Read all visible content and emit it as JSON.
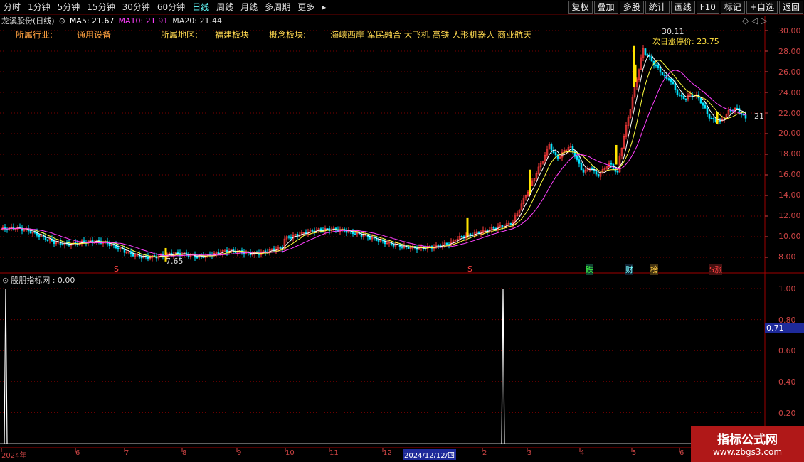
{
  "toolbar": {
    "periods": [
      "分时",
      "1分钟",
      "5分钟",
      "15分钟",
      "30分钟",
      "60分钟",
      "日线",
      "周线",
      "月线",
      "多周期",
      "更多"
    ],
    "buttons": [
      "复权",
      "叠加",
      "多股",
      "统计",
      "画线",
      "F10",
      "标记",
      "+自选",
      "返回"
    ]
  },
  "chart_header": {
    "stock": "龙溪股份(日线)",
    "ma5": "MA5: 21.67",
    "ma10": "MA10: 21.91",
    "ma20": "MA20: 21.44"
  },
  "tags": {
    "industry_label": "所属行业:",
    "industry_value": "通用设备",
    "region_label": "所属地区:",
    "region_value": "福建板块",
    "concept_label": "概念板块:",
    "concept_value": "海峡西岸 军民融合 大飞机 高铁 人形机器人 商业航天"
  },
  "notes": {
    "high": "30.11",
    "low": "7.65",
    "limit_up": "次日涨停价: 23.75",
    "last": "21"
  },
  "event_marks": [
    "S",
    "S",
    "跌",
    "财",
    "榜",
    "S涨"
  ],
  "price_axis": [
    "30.00",
    "28.00",
    "26.00",
    "24.00",
    "22.00",
    "20.00",
    "18.00",
    "16.00",
    "14.00",
    "12.00",
    "10.00",
    "8.00"
  ],
  "indicator": {
    "title": "股朋指标网 : 0.00",
    "axis": [
      "1.00",
      "0.80",
      "0.60",
      "0.40",
      "0.20"
    ],
    "cursor_value": "0.71"
  },
  "date_axis": [
    "2024年",
    "6",
    "7",
    "8",
    "9",
    "10",
    "11",
    "12",
    "2024/12/12/四",
    "2",
    "3",
    "4",
    "5",
    "6"
  ],
  "watermark": {
    "title": "指标公式网",
    "url": "www.zbgs3.com"
  },
  "colors": {
    "up": "#ff3b3b",
    "down": "#00e5ff",
    "ma5": "#ffffff",
    "ma10": "#ffff40",
    "ma20": "#ff40ff",
    "grid": "#7a0000"
  },
  "chart_data": {
    "type": "candlestick",
    "ylim": [
      7,
      31
    ],
    "indicator_ylim": [
      0,
      1
    ],
    "indicator_spikes": [
      1.0,
      1.0
    ]
  }
}
